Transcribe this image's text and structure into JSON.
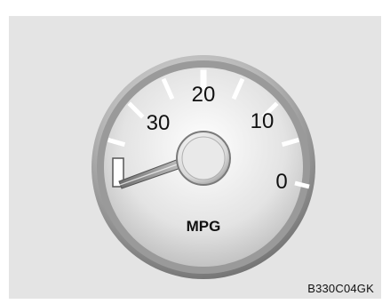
{
  "gauge": {
    "name": "fuel-economy-gauge",
    "unit_label": "MPG",
    "scale_labels": [
      "30",
      "20",
      "10",
      "0"
    ],
    "needle_value": "0 to 30 scale, needle near far left (about 35)"
  },
  "figure_code": "B330C04GK",
  "colors": {
    "panel": "#e4e4e4",
    "bezel_dark": "#6f6f6f",
    "bezel_light": "#d8d8d8",
    "face": "#c9c9c9",
    "ink": "#111111",
    "needle": "#777777"
  }
}
